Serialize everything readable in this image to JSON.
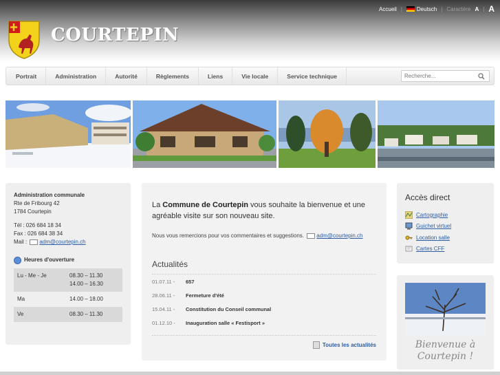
{
  "topbar": {
    "home": "Accueil",
    "language": "Deutsch",
    "charsize_label": "Caractère",
    "small_a": "A",
    "big_a": "A"
  },
  "site": {
    "title": "COURTEPIN"
  },
  "nav": {
    "items": [
      "Portrait",
      "Administration",
      "Autorité",
      "Règlements",
      "Liens",
      "Vie locale",
      "Service technique"
    ],
    "search_placeholder": "Recherche..."
  },
  "contact": {
    "title": "Administration communale",
    "street": "Rte de Fribourg 42",
    "city": "1784 Courtepin",
    "tel": "Tél : 026 684 18 34",
    "fax": "Fax : 026 684 38 34",
    "mail_label": "Mail :",
    "mail": "adm@courtepin.ch"
  },
  "hours": {
    "title": "Heures d'ouverture",
    "rows": [
      {
        "day": "Lu - Me - Je",
        "time1": "08.30 – 11.30",
        "time2": "14.00 – 16.30"
      },
      {
        "day": "Ma",
        "time1": "14.00 – 18.00",
        "time2": ""
      },
      {
        "day": "Ve",
        "time1": "08.30 – 11.30",
        "time2": ""
      }
    ]
  },
  "welcome": {
    "pre": "La ",
    "bold": "Commune de Courtepin",
    "post": " vous souhaite la bienvenue et une agréable visite sur son nouveau site.",
    "thanks": "Nous vous remercions pour vos commentaires et suggestions.",
    "mail": "adm@courtepin.ch"
  },
  "news": {
    "title": "Actualités",
    "items": [
      {
        "date": "01.07.11",
        "title": "657"
      },
      {
        "date": "28.06.11",
        "title": "Fermeture d'été"
      },
      {
        "date": "15.04.11",
        "title": "Constitution du Conseil communal"
      },
      {
        "date": "01.12.10",
        "title": "Inauguration salle « Festisport »"
      }
    ],
    "all": "Toutes les actualités"
  },
  "access": {
    "title": "Accès direct",
    "links": [
      "Cartographie",
      "Guichet virtuel",
      "Location salle",
      "Cartes CFF"
    ]
  },
  "promo": {
    "line1": "Bienvenue à",
    "line2": "Courtepin !"
  },
  "colors": {
    "link": "#2a5ca8",
    "panel": "#efefef",
    "nav_text": "#555555"
  }
}
